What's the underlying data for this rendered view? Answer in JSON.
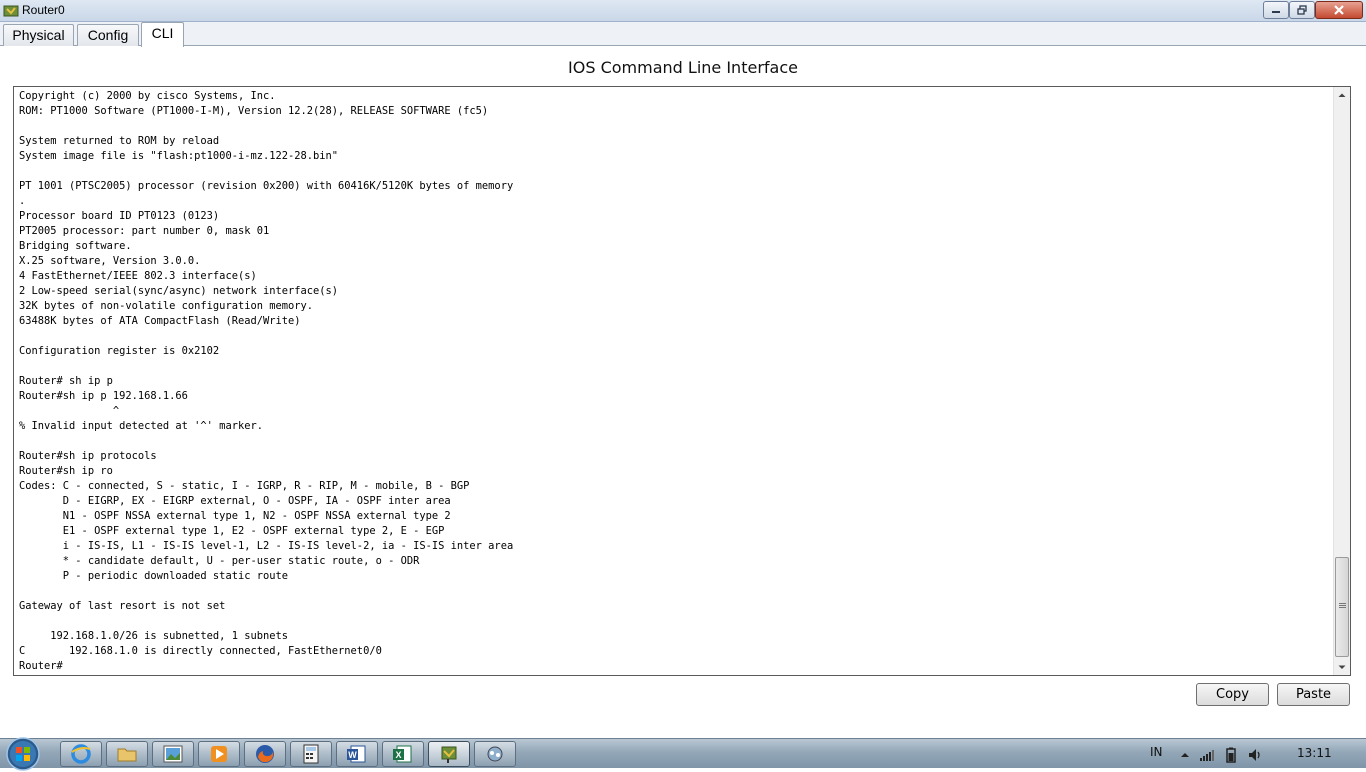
{
  "window": {
    "title": "Router0"
  },
  "tabs": [
    {
      "label": "Physical",
      "active": false
    },
    {
      "label": "Config",
      "active": false
    },
    {
      "label": "CLI",
      "active": true
    }
  ],
  "cli": {
    "heading": "IOS Command Line Interface",
    "lines": [
      "Copyright (c) 2000 by cisco Systems, Inc.",
      "ROM: PT1000 Software (PT1000-I-M), Version 12.2(28), RELEASE SOFTWARE (fc5)",
      "",
      "System returned to ROM by reload",
      "System image file is \"flash:pt1000-i-mz.122-28.bin\"",
      "",
      "PT 1001 (PTSC2005) processor (revision 0x200) with 60416K/5120K bytes of memory",
      ".",
      "Processor board ID PT0123 (0123)",
      "PT2005 processor: part number 0, mask 01",
      "Bridging software.",
      "X.25 software, Version 3.0.0.",
      "4 FastEthernet/IEEE 802.3 interface(s)",
      "2 Low-speed serial(sync/async) network interface(s)",
      "32K bytes of non-volatile configuration memory.",
      "63488K bytes of ATA CompactFlash (Read/Write)",
      "",
      "Configuration register is 0x2102",
      "",
      "Router# sh ip p",
      "Router#sh ip p 192.168.1.66",
      "               ^",
      "% Invalid input detected at '^' marker.",
      "",
      "Router#sh ip protocols",
      "Router#sh ip ro",
      "Codes: C - connected, S - static, I - IGRP, R - RIP, M - mobile, B - BGP",
      "       D - EIGRP, EX - EIGRP external, O - OSPF, IA - OSPF inter area",
      "       N1 - OSPF NSSA external type 1, N2 - OSPF NSSA external type 2",
      "       E1 - OSPF external type 1, E2 - OSPF external type 2, E - EGP",
      "       i - IS-IS, L1 - IS-IS level-1, L2 - IS-IS level-2, ia - IS-IS inter area",
      "       * - candidate default, U - per-user static route, o - ODR",
      "       P - periodic downloaded static route",
      "",
      "Gateway of last resort is not set",
      "",
      "     192.168.1.0/26 is subnetted, 1 subnets",
      "C       192.168.1.0 is directly connected, FastEthernet0/0",
      "Router#"
    ]
  },
  "buttons": {
    "copy": "Copy",
    "paste": "Paste"
  },
  "taskbar": {
    "pinned": [
      "internet-explorer-icon",
      "folder-icon",
      "image-viewer-icon",
      "media-player-icon",
      "firefox-icon",
      "calculator-app-icon",
      "word-icon",
      "excel-icon",
      "packet-tracer-icon",
      "network-app-icon"
    ],
    "language": "IN",
    "clock": "13:11"
  }
}
